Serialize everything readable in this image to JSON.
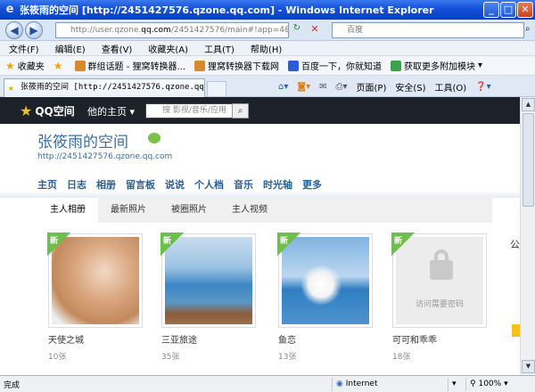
{
  "window": {
    "title": "张筱雨的空间 [http://2451427576.qzone.qq.com] - Windows Internet Explorer",
    "controls": [
      "minimize",
      "maximize",
      "close"
    ]
  },
  "addressbar": {
    "url_prefix": "http://user.qzone.",
    "url_host": "qq.com",
    "url_rest": "/2451427576/main#!app=4&vi",
    "search_placeholder": "百度"
  },
  "menubar": {
    "items": [
      "文件(F)",
      "编辑(E)",
      "查看(V)",
      "收藏夹(A)",
      "工具(T)",
      "帮助(H)"
    ]
  },
  "favorites": {
    "label": "收藏夹",
    "items": [
      "群组话题 - 狸窝转换器...",
      "狸窝转换器下载网",
      "百度一下，你就知道",
      "获取更多附加模块"
    ]
  },
  "tab": {
    "title": "张筱雨的空间 [http://2451427576.qzone.qq..."
  },
  "commandbar": {
    "items": [
      "页面(P)",
      "安全(S)",
      "工具(O)"
    ]
  },
  "qzone": {
    "logo": "QQ空间",
    "home_menu": "他的主页",
    "search_placeholder": "搜 影视/音乐/应用",
    "space_name": "张筱雨的空间",
    "space_url": "http://2451427576.qzone.qq.com",
    "nav": [
      "主页",
      "日志",
      "相册",
      "留言板",
      "说说",
      "个人档",
      "音乐",
      "时光轴",
      "更多"
    ],
    "album_tabs": [
      "主人相册",
      "最新照片",
      "被圈照片",
      "主人视频"
    ],
    "albums": [
      {
        "name": "天使之城",
        "count": "10张",
        "badge": "新"
      },
      {
        "name": "三亚旅途",
        "count": "35张",
        "badge": "新"
      },
      {
        "name": "鱼恋",
        "count": "13张",
        "badge": "新"
      },
      {
        "name": "可可和乖乖",
        "count": "18张",
        "badge": "新",
        "locked_text": "访问需要密码"
      }
    ],
    "side_text": "公"
  },
  "statusbar": {
    "status": "完成",
    "zone": "Internet",
    "zoom": "100%"
  }
}
